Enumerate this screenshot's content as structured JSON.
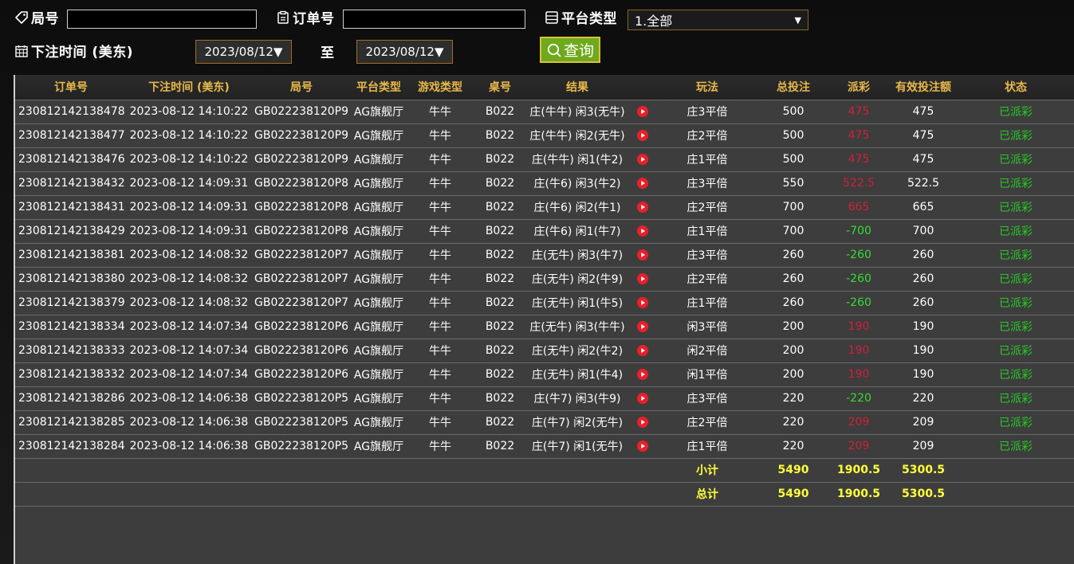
{
  "filters": {
    "round_label": "局号",
    "round_value": "",
    "order_label": "订单号",
    "order_value": "",
    "platform_label": "平台类型",
    "platform_selected": "1.全部",
    "time_label": "下注时间 (美东)",
    "date_from": "2023/08/12▼",
    "to_label": "至",
    "date_to": "2023/08/12▼",
    "query_label": "查询"
  },
  "table": {
    "headers": [
      "订单号",
      "下注时间 (美东)",
      "局号",
      "平台类型",
      "游戏类型",
      "桌号",
      "结果",
      "",
      "玩法",
      "总投注",
      "派彩",
      "有效投注额",
      "状态"
    ],
    "rows": [
      {
        "order": "230812142138478",
        "time": "2023-08-12 14:10:22",
        "round": "GB022238120P9",
        "platform": "AG旗舰厅",
        "game": "牛牛",
        "table": "B022",
        "result": "庄(牛牛) 闲3(无牛)",
        "play": "庄3平倍",
        "bet": "500",
        "payout": "475",
        "payout_color": "red",
        "valid": "475",
        "status": "已派彩"
      },
      {
        "order": "230812142138477",
        "time": "2023-08-12 14:10:22",
        "round": "GB022238120P9",
        "platform": "AG旗舰厅",
        "game": "牛牛",
        "table": "B022",
        "result": "庄(牛牛) 闲2(无牛)",
        "play": "庄2平倍",
        "bet": "500",
        "payout": "475",
        "payout_color": "red",
        "valid": "475",
        "status": "已派彩"
      },
      {
        "order": "230812142138476",
        "time": "2023-08-12 14:10:22",
        "round": "GB022238120P9",
        "platform": "AG旗舰厅",
        "game": "牛牛",
        "table": "B022",
        "result": "庄(牛牛) 闲1(牛2)",
        "play": "庄1平倍",
        "bet": "500",
        "payout": "475",
        "payout_color": "red",
        "valid": "475",
        "status": "已派彩"
      },
      {
        "order": "230812142138432",
        "time": "2023-08-12 14:09:31",
        "round": "GB022238120P8",
        "platform": "AG旗舰厅",
        "game": "牛牛",
        "table": "B022",
        "result": "庄(牛6) 闲3(牛2)",
        "play": "庄3平倍",
        "bet": "550",
        "payout": "522.5",
        "payout_color": "red",
        "valid": "522.5",
        "status": "已派彩"
      },
      {
        "order": "230812142138431",
        "time": "2023-08-12 14:09:31",
        "round": "GB022238120P8",
        "platform": "AG旗舰厅",
        "game": "牛牛",
        "table": "B022",
        "result": "庄(牛6) 闲2(牛1)",
        "play": "庄2平倍",
        "bet": "700",
        "payout": "665",
        "payout_color": "red",
        "valid": "665",
        "status": "已派彩"
      },
      {
        "order": "230812142138429",
        "time": "2023-08-12 14:09:31",
        "round": "GB022238120P8",
        "platform": "AG旗舰厅",
        "game": "牛牛",
        "table": "B022",
        "result": "庄(牛6) 闲1(牛7)",
        "play": "庄1平倍",
        "bet": "700",
        "payout": "-700",
        "payout_color": "green",
        "valid": "700",
        "status": "已派彩"
      },
      {
        "order": "230812142138381",
        "time": "2023-08-12 14:08:32",
        "round": "GB022238120P7",
        "platform": "AG旗舰厅",
        "game": "牛牛",
        "table": "B022",
        "result": "庄(无牛) 闲3(牛7)",
        "play": "庄3平倍",
        "bet": "260",
        "payout": "-260",
        "payout_color": "green",
        "valid": "260",
        "status": "已派彩"
      },
      {
        "order": "230812142138380",
        "time": "2023-08-12 14:08:32",
        "round": "GB022238120P7",
        "platform": "AG旗舰厅",
        "game": "牛牛",
        "table": "B022",
        "result": "庄(无牛) 闲2(牛9)",
        "play": "庄2平倍",
        "bet": "260",
        "payout": "-260",
        "payout_color": "green",
        "valid": "260",
        "status": "已派彩"
      },
      {
        "order": "230812142138379",
        "time": "2023-08-12 14:08:32",
        "round": "GB022238120P7",
        "platform": "AG旗舰厅",
        "game": "牛牛",
        "table": "B022",
        "result": "庄(无牛) 闲1(牛5)",
        "play": "庄1平倍",
        "bet": "260",
        "payout": "-260",
        "payout_color": "green",
        "valid": "260",
        "status": "已派彩"
      },
      {
        "order": "230812142138334",
        "time": "2023-08-12 14:07:34",
        "round": "GB022238120P6",
        "platform": "AG旗舰厅",
        "game": "牛牛",
        "table": "B022",
        "result": "庄(无牛) 闲3(牛牛)",
        "play": "闲3平倍",
        "bet": "200",
        "payout": "190",
        "payout_color": "red",
        "valid": "190",
        "status": "已派彩"
      },
      {
        "order": "230812142138333",
        "time": "2023-08-12 14:07:34",
        "round": "GB022238120P6",
        "platform": "AG旗舰厅",
        "game": "牛牛",
        "table": "B022",
        "result": "庄(无牛) 闲2(牛2)",
        "play": "闲2平倍",
        "bet": "200",
        "payout": "190",
        "payout_color": "red",
        "valid": "190",
        "status": "已派彩"
      },
      {
        "order": "230812142138332",
        "time": "2023-08-12 14:07:34",
        "round": "GB022238120P6",
        "platform": "AG旗舰厅",
        "game": "牛牛",
        "table": "B022",
        "result": "庄(无牛) 闲1(牛4)",
        "play": "闲1平倍",
        "bet": "200",
        "payout": "190",
        "payout_color": "red",
        "valid": "190",
        "status": "已派彩"
      },
      {
        "order": "230812142138286",
        "time": "2023-08-12 14:06:38",
        "round": "GB022238120P5",
        "platform": "AG旗舰厅",
        "game": "牛牛",
        "table": "B022",
        "result": "庄(牛7) 闲3(牛9)",
        "play": "庄3平倍",
        "bet": "220",
        "payout": "-220",
        "payout_color": "green",
        "valid": "220",
        "status": "已派彩"
      },
      {
        "order": "230812142138285",
        "time": "2023-08-12 14:06:38",
        "round": "GB022238120P5",
        "platform": "AG旗舰厅",
        "game": "牛牛",
        "table": "B022",
        "result": "庄(牛7) 闲2(无牛)",
        "play": "庄2平倍",
        "bet": "220",
        "payout": "209",
        "payout_color": "red",
        "valid": "209",
        "status": "已派彩"
      },
      {
        "order": "230812142138284",
        "time": "2023-08-12 14:06:38",
        "round": "GB022238120P5",
        "platform": "AG旗舰厅",
        "game": "牛牛",
        "table": "B022",
        "result": "庄(牛7) 闲1(无牛)",
        "play": "庄1平倍",
        "bet": "220",
        "payout": "209",
        "payout_color": "red",
        "valid": "209",
        "status": "已派彩"
      }
    ],
    "subtotal": {
      "label": "小计",
      "bet": "5490",
      "payout": "1900.5",
      "valid": "5300.5"
    },
    "total": {
      "label": "总计",
      "bet": "5490",
      "payout": "1900.5",
      "valid": "5300.5"
    }
  },
  "colors": {
    "header_text": "#e8b94a",
    "payout_red": "#d0203a",
    "payout_green": "#33dd33",
    "status_green": "#25c925",
    "sum_text": "#ffff3a",
    "query_button": "#6fa91c"
  },
  "icons": {
    "round": "tag-icon",
    "order": "clipboard-icon",
    "platform": "list-icon",
    "time": "calendar-icon",
    "query": "search-icon",
    "replay": "play-circle-icon"
  }
}
